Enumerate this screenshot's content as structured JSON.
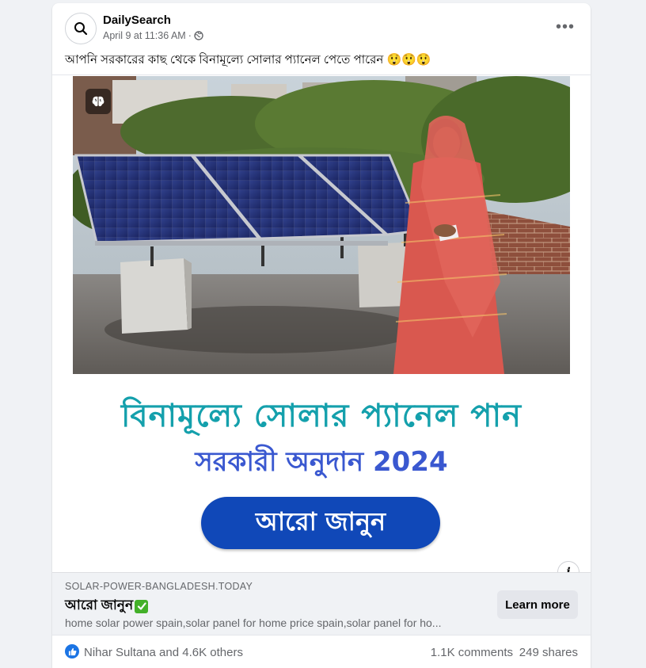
{
  "post": {
    "page_name": "DailySearch",
    "timestamp": "April 9 at 11:36 AM",
    "separator": "·",
    "audience_icon": "globe-icon",
    "text": "আপনি সরকারের কাছ থেকে বিনামূল্যে সোলার প্যানেল পেতে পারেন",
    "emojis": [
      "😲",
      "😲",
      "😲"
    ]
  },
  "creative": {
    "headline_line1": "বিনামূল্যে সোলার প্যানেল পান",
    "headline_line2": "সরকারী অনুদান 2024",
    "cta_label": "আরো জানুন",
    "colors": {
      "headline1": "#14a0ac",
      "headline2": "#3a58d0",
      "cta_bg": "#1048b8"
    }
  },
  "link": {
    "domain": "SOLAR-POWER-BANGLADESH.TODAY",
    "title": "আরো জানুন",
    "title_badge_icon": "check-mark-icon",
    "description": "home solar power spain,solar panel for home price spain,solar panel for ho...",
    "button_label": "Learn more"
  },
  "footer": {
    "reactors": "Nihar Sultana and 4.6K others",
    "comments": "1.1K comments",
    "shares": "249 shares"
  }
}
